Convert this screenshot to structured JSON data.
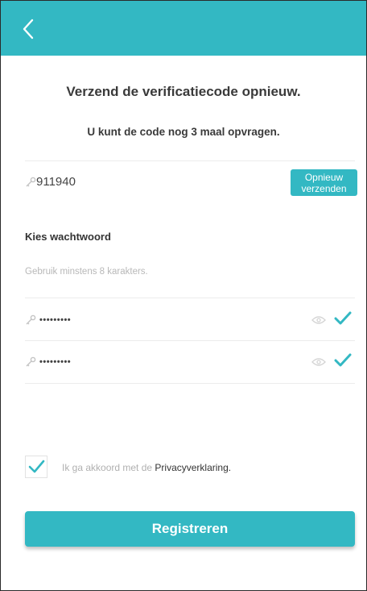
{
  "colors": {
    "accent": "#33b8c3",
    "hint": "#b8b8b8"
  },
  "header": {
    "back_icon": "chevron-left-icon"
  },
  "verification": {
    "title": "Verzend de verificatiecode opnieuw.",
    "subtitle": "U kunt de code nog 3 maal opvragen.",
    "code_value": "911940",
    "resend_line1": "Opnieuw",
    "resend_line2": "verzenden"
  },
  "password": {
    "section_label": "Kies wachtwoord",
    "hint": "Gebruik minstens 8 karakters.",
    "password_value": "•••••••••",
    "confirm_value": "•••••••••"
  },
  "agreement": {
    "checked": true,
    "prefix": "Ik ga akkoord met de ",
    "link": "Privacyverklaring",
    "suffix": "."
  },
  "actions": {
    "register_label": "Registreren"
  }
}
